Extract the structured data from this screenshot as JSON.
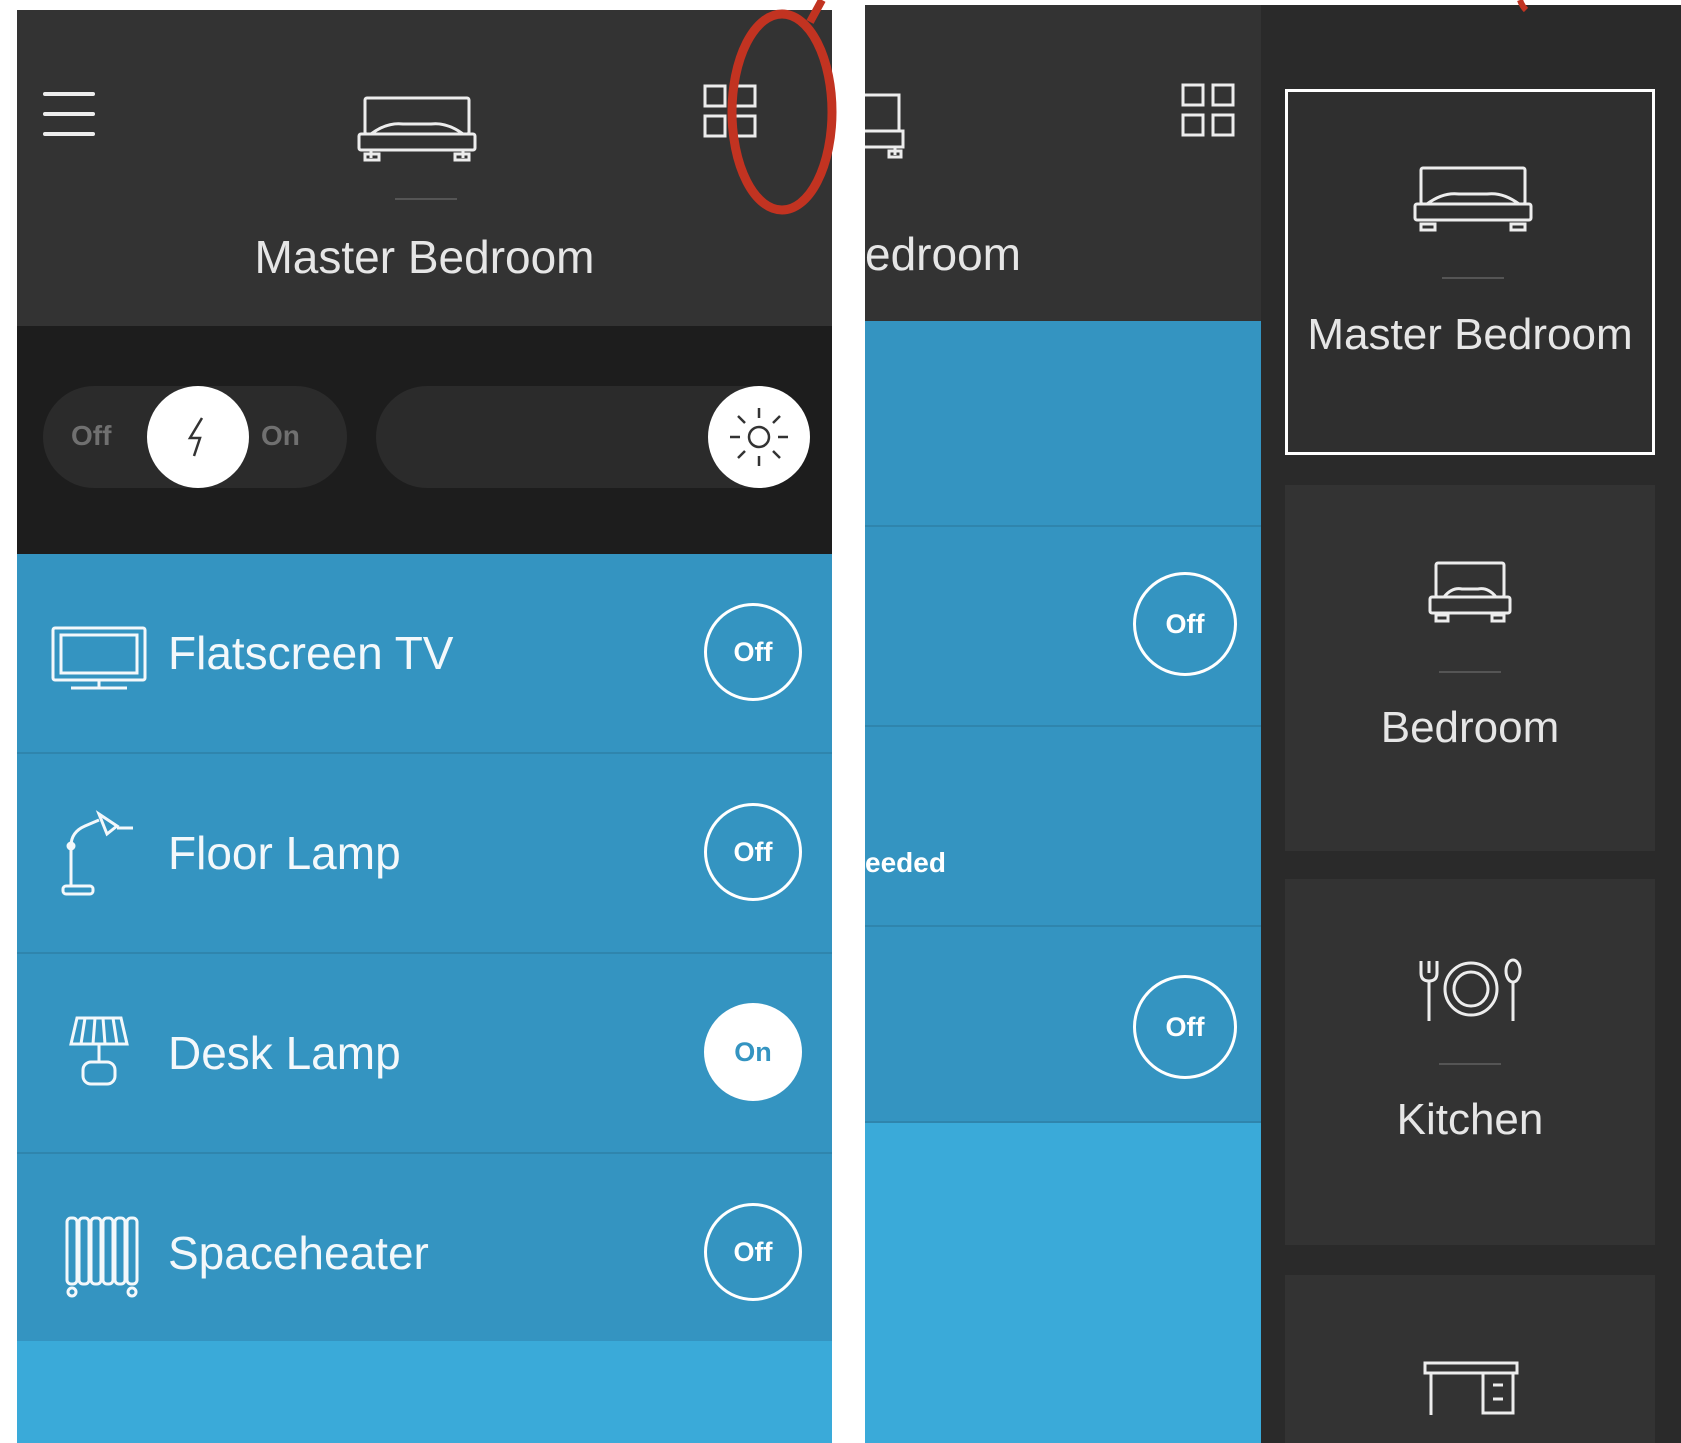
{
  "left": {
    "header": {
      "room_title": "Master Bedroom",
      "menu_icon": "hamburger-menu-icon",
      "room_icon": "bed-icon",
      "grid_icon": "grid-view-icon"
    },
    "controls": {
      "power": {
        "off_label": "Off",
        "on_label": "On",
        "state": "unset"
      },
      "brightness_icon": "sun-icon"
    },
    "devices": [
      {
        "name": "Flatscreen TV",
        "icon": "tv-icon",
        "state": "Off",
        "on": false
      },
      {
        "name": "Floor Lamp",
        "icon": "floor-lamp-icon",
        "state": "Off",
        "on": false
      },
      {
        "name": "Desk Lamp",
        "icon": "desk-lamp-icon",
        "state": "On",
        "on": true
      },
      {
        "name": "Spaceheater",
        "icon": "radiator-icon",
        "state": "Off",
        "on": false
      }
    ]
  },
  "right": {
    "main": {
      "title_fragment": "edroom",
      "status_fragment": "eeded",
      "toggles": [
        "Off",
        "Off"
      ]
    },
    "rooms": [
      {
        "name": "Master Bedroom",
        "icon": "bed-icon",
        "selected": true
      },
      {
        "name": "Bedroom",
        "icon": "small-bed-icon",
        "selected": false
      },
      {
        "name": "Kitchen",
        "icon": "dining-icon",
        "selected": false
      },
      {
        "name": "",
        "icon": "desk-icon",
        "selected": false
      }
    ]
  },
  "colors": {
    "header": "#333333",
    "control_bar": "#1d1d1d",
    "device_row": "#3494c1",
    "accent_blue": "#3aaad9",
    "annotation_red": "#c23321"
  }
}
